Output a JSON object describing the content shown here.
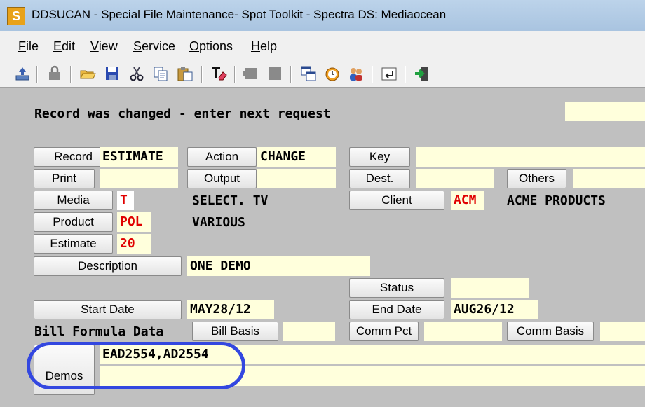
{
  "window": {
    "title": "DDSUCAN - Special File Maintenance- Spot Toolkit - Spectra DS: Mediaocean",
    "icon_letter": "S"
  },
  "menu": {
    "items": [
      {
        "label": "File"
      },
      {
        "label": "Edit"
      },
      {
        "label": "View"
      },
      {
        "label": "Service"
      },
      {
        "label": "Options"
      },
      {
        "label": "Help"
      }
    ]
  },
  "toolbar": {
    "icons": [
      "send-icon",
      "lock-icon",
      "open-folder-icon",
      "save-icon",
      "cut-icon",
      "copy-icon",
      "paste-icon",
      "erase-icon",
      "record-icon",
      "stop-icon",
      "windows-icon",
      "clock-icon",
      "users-icon",
      "enter-icon",
      "exit-icon"
    ]
  },
  "status": {
    "message": "Record was changed - enter next request"
  },
  "form": {
    "record_label": "Record",
    "record_value": "ESTIMATE",
    "action_label": "Action",
    "action_value": "CHANGE",
    "key_label": "Key",
    "print_label": "Print",
    "output_label": "Output",
    "dest_label": "Dest.",
    "others_label": "Others",
    "media_label": "Media",
    "media_value": "T",
    "media_name": "SELECT. TV",
    "client_label": "Client",
    "client_value": "ACM",
    "client_name": "ACME PRODUCTS",
    "product_label": "Product",
    "product_value": "POL",
    "product_name": "VARIOUS",
    "estimate_label": "Estimate",
    "estimate_value": "20",
    "description_label": "Description",
    "description_value": "ONE DEMO",
    "status_label": "Status",
    "start_date_label": "Start Date",
    "start_date_value": "MAY28/12",
    "end_date_label": "End Date",
    "end_date_value": "AUG26/12",
    "bill_formula_label": "Bill Formula Data",
    "bill_basis_label": "Bill Basis",
    "comm_pct_label": "Comm Pct",
    "comm_basis_label": "Comm Basis",
    "demos_label": "Demos",
    "demos_value": "EAD2554,AD2554"
  },
  "colors": {
    "field_bg": "#ffffdc",
    "value_red": "#e00000",
    "highlight_circle": "#3347e0"
  }
}
